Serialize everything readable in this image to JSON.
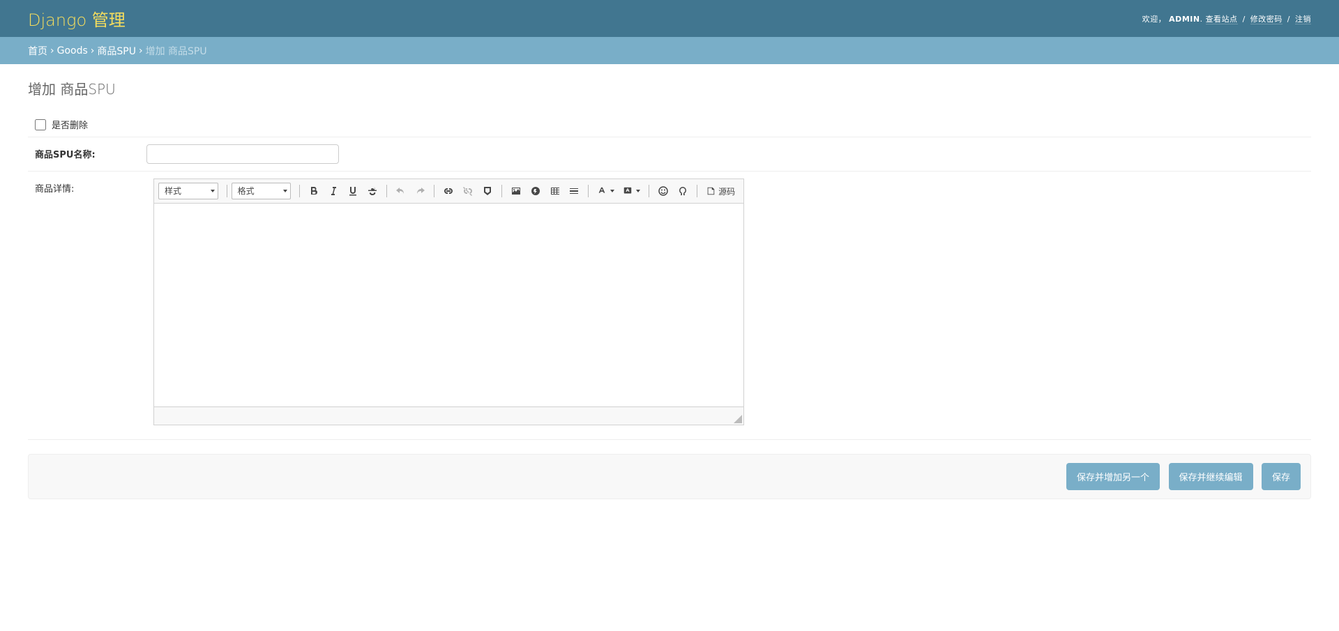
{
  "header": {
    "site_name": "Django 管理",
    "welcome": "欢迎，",
    "username": "ADMIN",
    "view_site": "查看站点",
    "change_password": "修改密码",
    "logout": "注销"
  },
  "breadcrumbs": {
    "home": "首页",
    "app": "Goods",
    "model": "商品SPU",
    "current": "增加 商品SPU"
  },
  "page": {
    "title": "增加 商品SPU"
  },
  "fields": {
    "is_delete_label": "是否删除",
    "name_label": "商品SPU名称:",
    "detail_label": "商品详情:"
  },
  "ckeditor": {
    "styles_label": "样式",
    "format_label": "格式",
    "source_label": "源码"
  },
  "actions": {
    "save_add_another": "保存并增加另一个",
    "save_continue": "保存并继续编辑",
    "save": "保存"
  }
}
